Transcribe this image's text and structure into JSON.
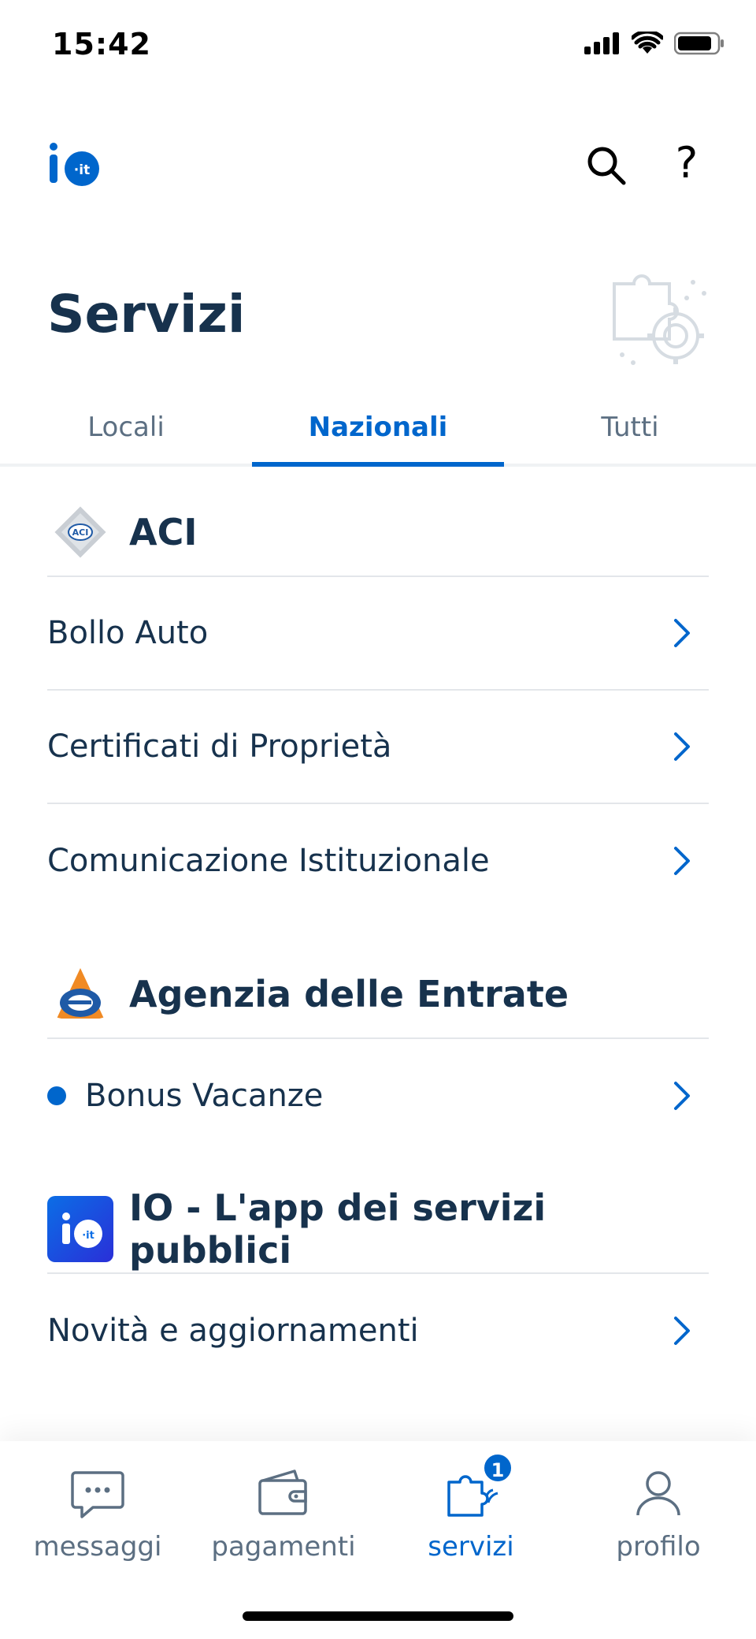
{
  "status_bar": {
    "time": "15:42"
  },
  "header": {
    "logo_text": "io",
    "logo_suffix": "·it",
    "help_label": "?"
  },
  "page": {
    "title": "Servizi"
  },
  "tabs": [
    {
      "label": "Locali",
      "active": false
    },
    {
      "label": "Nazionali",
      "active": true
    },
    {
      "label": "Tutti",
      "active": false
    }
  ],
  "organizations": [
    {
      "name": "ACI",
      "logo_text": "ACI",
      "services": [
        {
          "label": "Bollo Auto",
          "unread": false
        },
        {
          "label": "Certificati di Proprietà",
          "unread": false
        },
        {
          "label": "Comunicazione Istituzionale",
          "unread": false
        }
      ]
    },
    {
      "name": "Agenzia delle Entrate",
      "services": [
        {
          "label": "Bonus Vacanze",
          "unread": true
        }
      ]
    },
    {
      "name": "IO - L'app dei servizi pubblici",
      "services": [
        {
          "label": "Novità e aggiornamenti",
          "unread": false
        }
      ]
    }
  ],
  "tabbar": {
    "items": [
      {
        "label": "messaggi",
        "icon": "chat-icon",
        "active": false
      },
      {
        "label": "pagamenti",
        "icon": "wallet-icon",
        "active": false
      },
      {
        "label": "servizi",
        "icon": "puzzle-icon",
        "active": true,
        "badge": "1"
      },
      {
        "label": "profilo",
        "icon": "user-icon",
        "active": false
      }
    ]
  },
  "colors": {
    "accent": "#0066cc",
    "text": "#17324d",
    "muted": "#5c6f82"
  }
}
